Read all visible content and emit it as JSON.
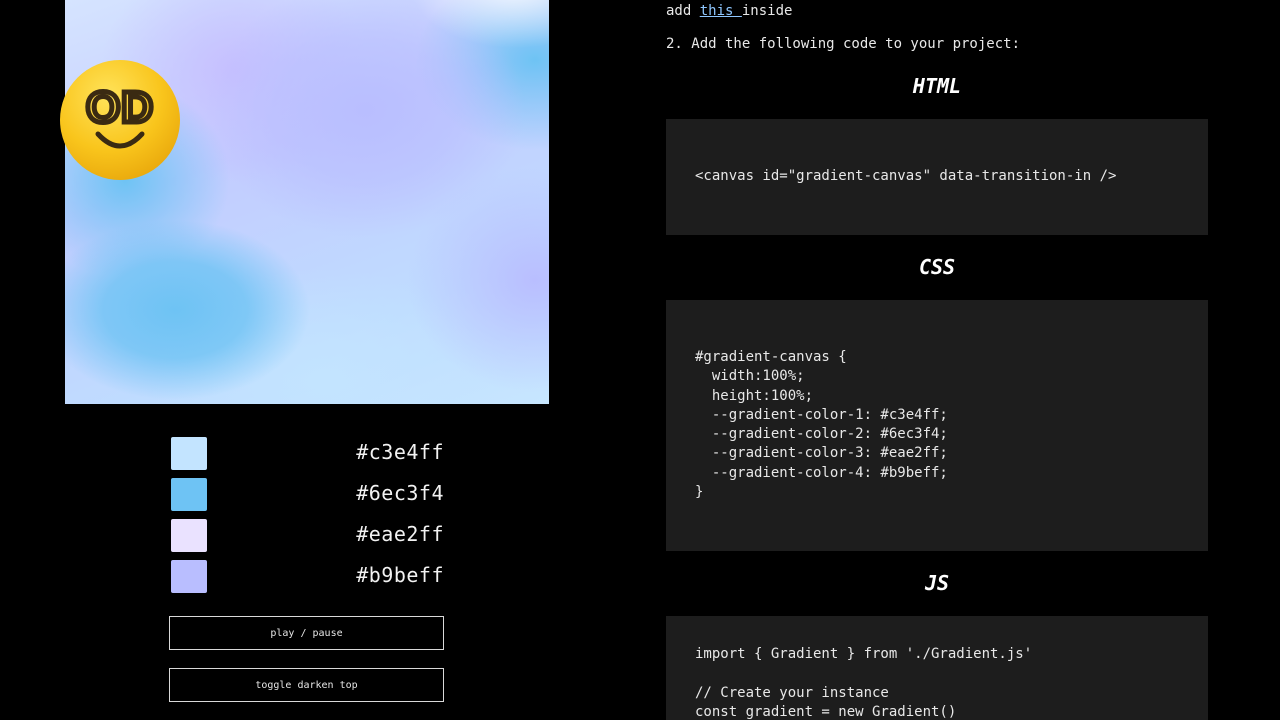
{
  "swatches": [
    {
      "hex": "#c3e4ff",
      "color": "#c3e4ff"
    },
    {
      "hex": "#6ec3f4",
      "color": "#6ec3f4"
    },
    {
      "hex": "#eae2ff",
      "color": "#eae2ff"
    },
    {
      "hex": "#b9beff",
      "color": "#b9beff"
    }
  ],
  "controls": {
    "play_label": "play / pause",
    "darken_label": "toggle darken top"
  },
  "avatar": {
    "icon": "smiley-od-icon",
    "text": "OD",
    "color": "#f7c21a"
  },
  "instructions": {
    "intro_prefix": "add ",
    "intro_link": "this ",
    "intro_suffix": "inside",
    "step2": "2. Add the following code to your project:"
  },
  "sections": {
    "html": {
      "heading": "HTML",
      "code": "<canvas id=\"gradient-canvas\" data-transition-in />"
    },
    "css": {
      "heading": "CSS",
      "code": "#gradient-canvas {\n  width:100%;\n  height:100%;\n  --gradient-color-1: #c3e4ff;\n  --gradient-color-2: #6ec3f4;\n  --gradient-color-3: #eae2ff;\n  --gradient-color-4: #b9beff;\n}"
    },
    "js": {
      "heading": "JS",
      "code": "import { Gradient } from './Gradient.js'\n\n// Create your instance\nconst gradient = new Gradient()"
    }
  }
}
